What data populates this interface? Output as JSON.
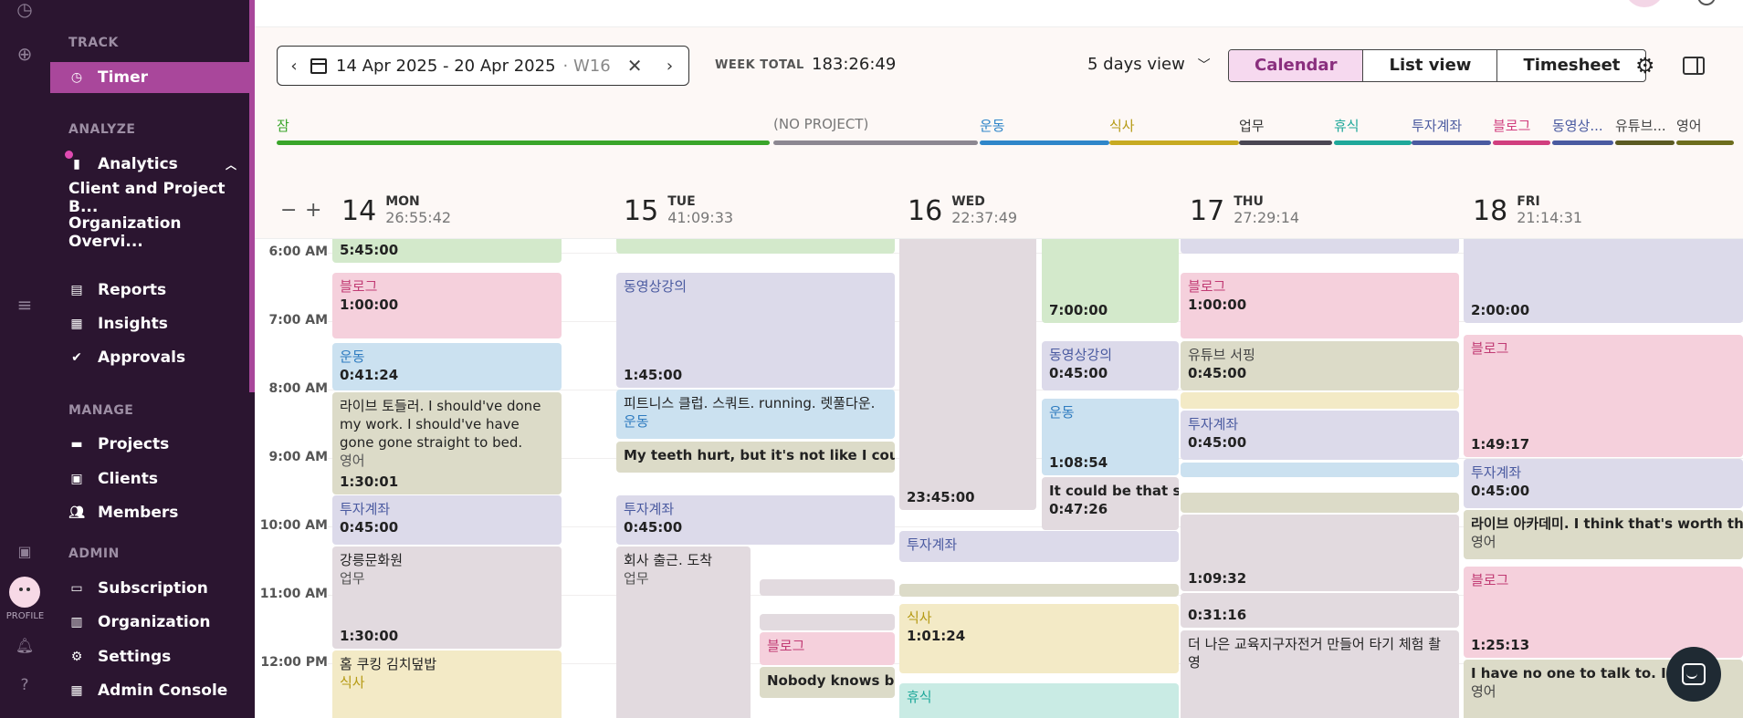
{
  "rail": {
    "profile_label": "PROFILE"
  },
  "sidebar": {
    "sections": {
      "track": "TRACK",
      "analyze": "ANALYZE",
      "manage": "MANAGE",
      "admin": "ADMIN"
    },
    "items": {
      "timer": "Timer",
      "analytics": "Analytics",
      "client_project": "Client and Project B...",
      "org_overview": "Organization Overvi...",
      "reports": "Reports",
      "insights": "Insights",
      "approvals": "Approvals",
      "projects": "Projects",
      "clients": "Clients",
      "members": "Members",
      "subscription": "Subscription",
      "organization": "Organization",
      "settings": "Settings",
      "admin_console": "Admin Console"
    }
  },
  "toolbar": {
    "date_range": "14 Apr 2025 - 20 Apr 2025",
    "week_tag": "· W16",
    "week_total_label": "WEEK TOTAL",
    "week_total_value": "183:26:49",
    "view_select": "5 days view",
    "tabs": {
      "calendar": "Calendar",
      "list": "List view",
      "timesheet": "Timesheet"
    }
  },
  "projects": [
    {
      "name": "잠",
      "color": "#3aa52a",
      "text": "#3aa52a"
    },
    {
      "name": "(NO PROJECT)",
      "color": "#8c8791",
      "text": "#777"
    },
    {
      "name": "운동",
      "color": "#2f86c9",
      "text": "#2f86c9"
    },
    {
      "name": "식사",
      "color": "#c7aa22",
      "text": "#b59a14"
    },
    {
      "name": "업무",
      "color": "#4a4652",
      "text": "#333"
    },
    {
      "name": "휴식",
      "color": "#1fa89a",
      "text": "#1fa89a"
    },
    {
      "name": "투자계좌",
      "color": "#4a5aa0",
      "text": "#4a5aa0"
    },
    {
      "name": "블로그",
      "color": "#d13e7e",
      "text": "#d13e7e"
    },
    {
      "name": "동영상...",
      "color": "#4a5aa0",
      "text": "#4a5aa0"
    },
    {
      "name": "유튜브...",
      "color": "#5b5a22",
      "text": "#444"
    },
    {
      "name": "영어",
      "color": "#6d6d1d",
      "text": "#444"
    }
  ],
  "days": [
    {
      "num": "14",
      "name": "MON",
      "total": "26:55:42"
    },
    {
      "num": "15",
      "name": "TUE",
      "total": "41:09:33"
    },
    {
      "num": "16",
      "name": "WED",
      "total": "22:37:49"
    },
    {
      "num": "17",
      "name": "THU",
      "total": "27:29:14"
    },
    {
      "num": "18",
      "name": "FRI",
      "total": "21:14:31"
    }
  ],
  "hours": [
    "6:00 AM",
    "7:00 AM",
    "8:00 AM",
    "9:00 AM",
    "10:00 AM",
    "11:00 AM",
    "12:00 PM"
  ],
  "events": {
    "mon": [
      {
        "desc": "",
        "project": "",
        "dur": "5:45:00"
      },
      {
        "desc": "",
        "project": "블로그",
        "dur": "1:00:00"
      },
      {
        "desc": "",
        "project": "운동",
        "dur": "0:41:24"
      },
      {
        "desc": "라이브 토들러. I should've done my work. I should've have gone gone straight to bed.",
        "project": "영어",
        "dur": "1:30:01"
      },
      {
        "desc": "",
        "project": "투자계좌",
        "dur": "0:45:00"
      },
      {
        "desc": "강릉문화원",
        "project": "업무",
        "dur": "1:30:00"
      },
      {
        "desc": "홈 쿠킹 김치덮밥",
        "project": "식사",
        "dur": ""
      }
    ],
    "tue": [
      {
        "desc": "",
        "project": "동영상강의",
        "dur": "1:45:00"
      },
      {
        "desc": "피트니스 클럽. 스쿼트. running. 렛풀다운.",
        "project": "운동",
        "dur": ""
      },
      {
        "desc": "My teeth hurt, but it's not like I couldn't st",
        "project": "",
        "dur": ""
      },
      {
        "desc": "",
        "project": "투자계좌",
        "dur": "0:45:00"
      },
      {
        "desc": "회사 출근. 도착",
        "project": "업무",
        "dur": ""
      },
      {
        "desc": "",
        "project": "블로그",
        "dur": ""
      },
      {
        "desc": "Nobody knows bett",
        "project": "",
        "dur": ""
      }
    ],
    "wed": [
      {
        "desc": "",
        "project": "",
        "dur": "23:45:00"
      },
      {
        "desc": "",
        "project": "",
        "dur": "7:00:00"
      },
      {
        "desc": "",
        "project": "동영상강의",
        "dur": "0:45:00"
      },
      {
        "desc": "",
        "project": "운동",
        "dur": "1:08:54"
      },
      {
        "desc": "It could be that she",
        "project": "",
        "dur": "0:47:26"
      },
      {
        "desc": "",
        "project": "투자계좌",
        "dur": ""
      },
      {
        "desc": "",
        "project": "식사",
        "dur": "1:01:24"
      },
      {
        "desc": "",
        "project": "휴식",
        "dur": ""
      }
    ],
    "thu": [
      {
        "desc": "",
        "project": "블로그",
        "dur": "1:00:00"
      },
      {
        "desc": "",
        "project": "유튜브 서핑",
        "dur": "0:45:00"
      },
      {
        "desc": "",
        "project": "투자계좌",
        "dur": "0:45:00"
      },
      {
        "desc": "",
        "project": "",
        "dur": "1:09:32"
      },
      {
        "desc": "",
        "project": "",
        "dur": "0:31:16"
      },
      {
        "desc": "더 나은 교육지구자전거 만들어 타기 체험 촬영",
        "project": "",
        "dur": ""
      }
    ],
    "fri": [
      {
        "desc": "",
        "project": "",
        "dur": "2:00:00"
      },
      {
        "desc": "",
        "project": "블로그",
        "dur": "1:49:17"
      },
      {
        "desc": "",
        "project": "투자계좌",
        "dur": "0:45:00"
      },
      {
        "desc": "라이브 아카데미. I think that's worth thinkin",
        "project": "영어",
        "dur": ""
      },
      {
        "desc": "",
        "project": "블로그",
        "dur": "1:25:13"
      },
      {
        "desc": "I have no one to talk to. I like t",
        "project": "영어",
        "dur": ""
      }
    ]
  }
}
